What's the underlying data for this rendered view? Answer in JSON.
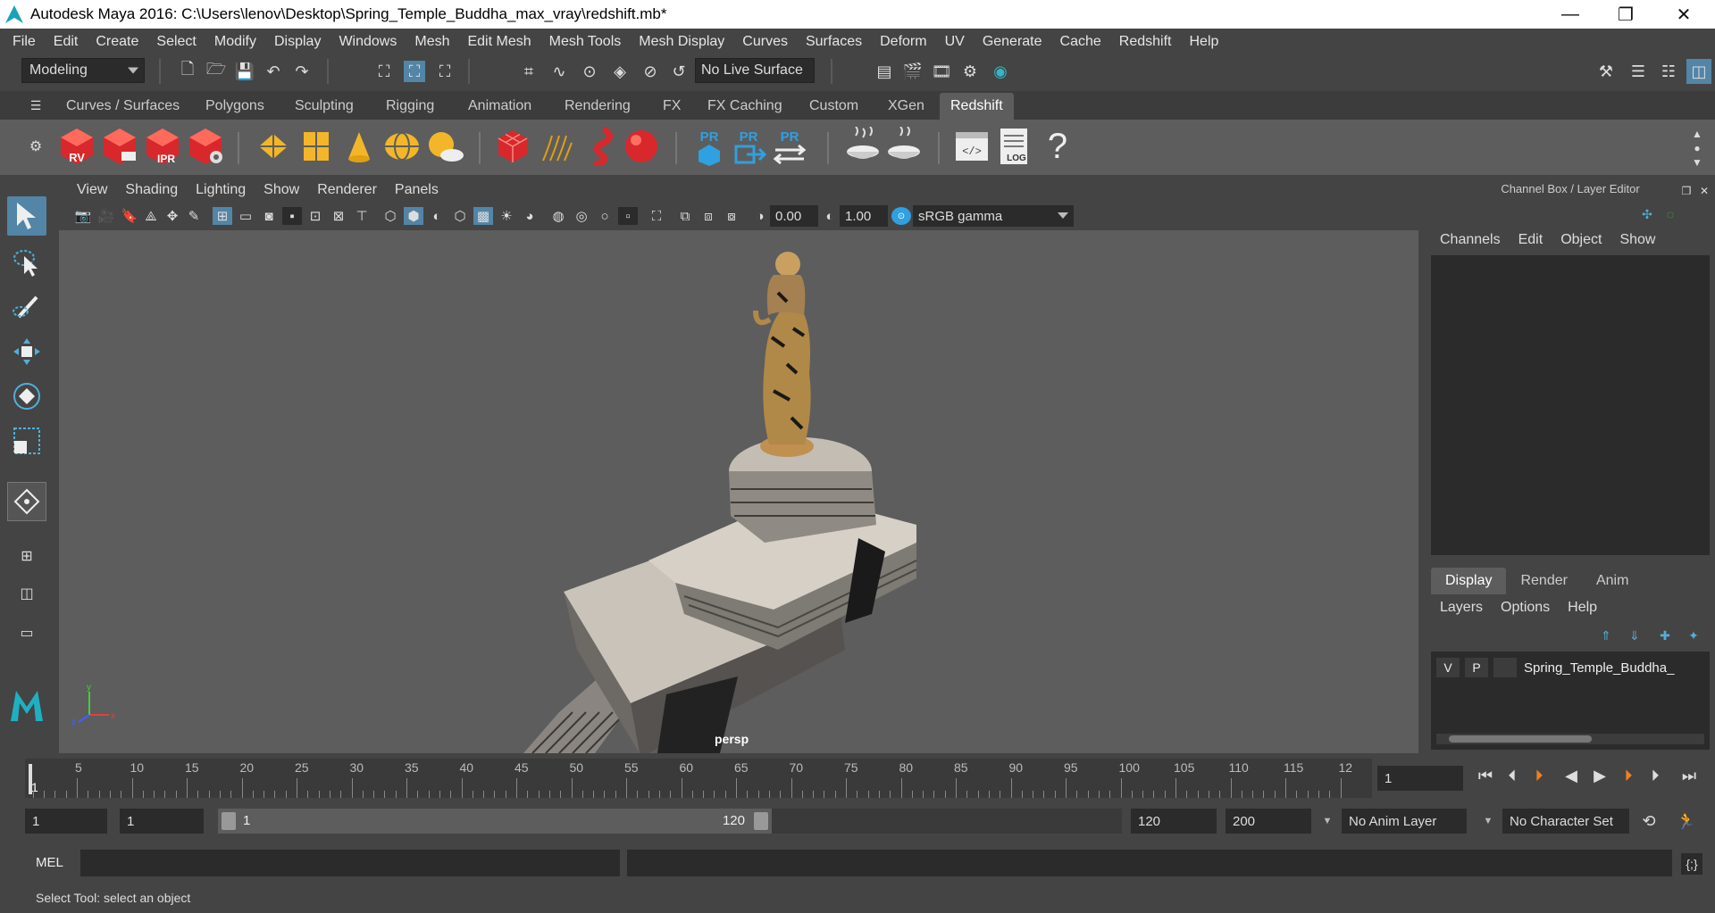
{
  "window": {
    "title": "Autodesk Maya 2016: C:\\Users\\lenov\\Desktop\\Spring_Temple_Buddha_max_vray\\redshift.mb*",
    "minimize_glyph": "—",
    "maximize_glyph": "❐",
    "close_glyph": "✕"
  },
  "menubar": [
    "File",
    "Edit",
    "Create",
    "Select",
    "Modify",
    "Display",
    "Windows",
    "Mesh",
    "Edit Mesh",
    "Mesh Tools",
    "Mesh Display",
    "Curves",
    "Surfaces",
    "Deform",
    "UV",
    "Generate",
    "Cache",
    "Redshift",
    "Help"
  ],
  "statusline": {
    "mode": "Modeling",
    "live_surface": "No Live Surface"
  },
  "shelf": {
    "tabs": [
      "Curves / Surfaces",
      "Polygons",
      "Sculpting",
      "Rigging",
      "Animation",
      "Rendering",
      "FX",
      "FX Caching",
      "Custom",
      "XGen",
      "Redshift"
    ],
    "active_tab": "Redshift",
    "labels": {
      "rv": "RV",
      "ipr": "IPR",
      "pr": "PR",
      "log": "LOG",
      "help": "?"
    }
  },
  "viewport": {
    "menu": [
      "View",
      "Shading",
      "Lighting",
      "Show",
      "Renderer",
      "Panels"
    ],
    "exposure": "0.00",
    "gamma": "1.00",
    "color_space": "sRGB gamma",
    "camera": "persp",
    "axis_labels": {
      "x": "x",
      "y": "y",
      "z": "z"
    }
  },
  "channel_box": {
    "title": "Channel Box / Layer Editor",
    "menu": [
      "Channels",
      "Edit",
      "Object",
      "Show"
    ]
  },
  "layer_editor": {
    "tabs": [
      "Display",
      "Render",
      "Anim"
    ],
    "active_tab": "Display",
    "menu": [
      "Layers",
      "Options",
      "Help"
    ],
    "layer": {
      "visible": "V",
      "playback": "P",
      "name": "Spring_Temple_Buddha_"
    }
  },
  "time_slider": {
    "ticks": [
      "5",
      "10",
      "15",
      "20",
      "25",
      "30",
      "35",
      "40",
      "45",
      "50",
      "55",
      "60",
      "65",
      "70",
      "75",
      "80",
      "85",
      "90",
      "95",
      "100",
      "105",
      "110",
      "115",
      "12"
    ],
    "current_marker": "1",
    "current_frame": "1"
  },
  "range": {
    "start": "1",
    "playback_start": "1",
    "slider_start": "1",
    "slider_end": "120",
    "playback_end": "120",
    "end": "200",
    "anim_layer": "No Anim Layer",
    "character_set": "No Character Set"
  },
  "command_line": {
    "language": "MEL"
  },
  "help_line": "Select Tool: select an object",
  "colors": {
    "accent": "#5285a6",
    "redshift_red": "#d8282c",
    "shelf_yellow": "#f2b628",
    "pr_blue": "#2fa0e0"
  }
}
